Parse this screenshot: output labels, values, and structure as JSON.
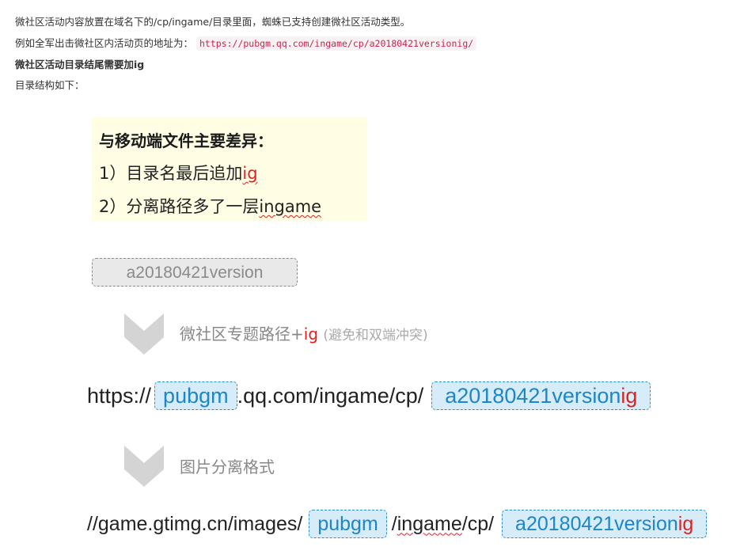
{
  "intro": {
    "line1": "微社区活动内容放置在域名下的/cp/ingame/目录里面，蜘蛛已支持创建微社区活动类型。",
    "line2_prefix": "例如全军出击微社区内活动页的地址为：",
    "line2_url": "https://pubgm.qq.com/ingame/cp/a20180421versionig/",
    "line3": "微社区活动目录结尾需要加ig",
    "line4": "目录结构如下："
  },
  "note": {
    "title": "与移动端文件主要差异：",
    "item1_text": "1）目录名最后追加",
    "item1_highlight": "ig",
    "item2_text": "2）分离路径多了一层",
    "item2_highlight": "ingame"
  },
  "source_dir": "a20180421version",
  "step1": {
    "label": "微社区专题路径+",
    "label_highlight": "ig",
    "note": "(避免和双端冲突)",
    "icon": "chevron-down-icon"
  },
  "url1": {
    "prefix": "https://",
    "tag1": "pubgm",
    "middle": ".qq.com/ingame/cp/",
    "tag2_text": "a20180421version",
    "tag2_suffix": "ig"
  },
  "step2": {
    "label": "图片分离格式",
    "icon": "chevron-down-icon"
  },
  "url2": {
    "prefix": "//game.gtimg.cn/images/",
    "tag1": "pubgm",
    "middle_a": "/",
    "middle_b": "ingame",
    "middle_c": "/cp/",
    "tag2_text": "a20180421version",
    "tag2_suffix": "ig"
  },
  "colors": {
    "highlight_red": "#e02020",
    "tag_blue_bg": "#d6ecf8",
    "tag_blue_text": "#1d86c8",
    "note_bg": "#fffde4",
    "chevron_grey": "#d4d4d4"
  }
}
